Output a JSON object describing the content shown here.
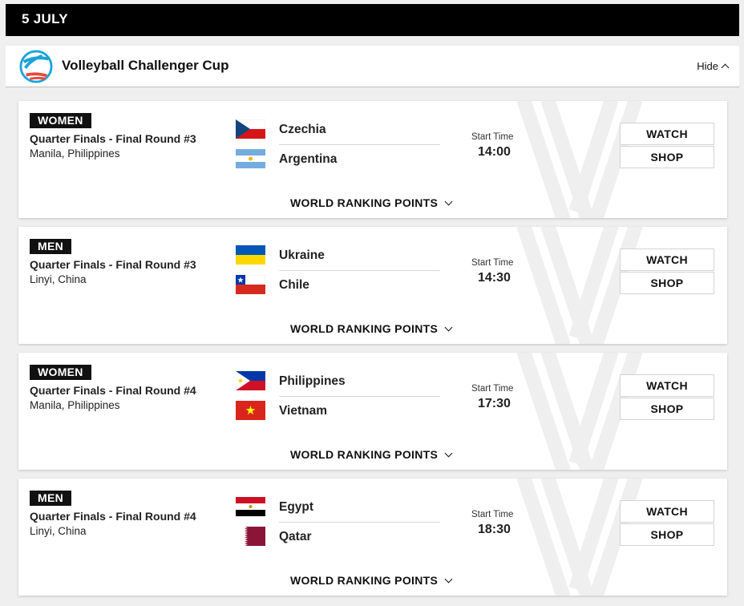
{
  "date_header": "5 JULY",
  "competition": {
    "title": "Volleyball Challenger Cup",
    "hide_label": "Hide"
  },
  "labels": {
    "start_time": "Start Time",
    "watch": "WATCH",
    "shop": "SHOP",
    "ranking_points": "WORLD RANKING POINTS"
  },
  "matches": [
    {
      "gender": "WOMEN",
      "round": "Quarter Finals - Final Round #3",
      "venue": "Manila, Philippines",
      "team1": {
        "name": "Czechia",
        "flag": "czechia-flag"
      },
      "team2": {
        "name": "Argentina",
        "flag": "argentina-flag"
      },
      "start_time": "14:00"
    },
    {
      "gender": "MEN",
      "round": "Quarter Finals - Final Round #3",
      "venue": "Linyi, China",
      "team1": {
        "name": "Ukraine",
        "flag": "ukraine-flag"
      },
      "team2": {
        "name": "Chile",
        "flag": "chile-flag"
      },
      "start_time": "14:30"
    },
    {
      "gender": "WOMEN",
      "round": "Quarter Finals - Final Round #4",
      "venue": "Manila, Philippines",
      "team1": {
        "name": "Philippines",
        "flag": "philippines-flag"
      },
      "team2": {
        "name": "Vietnam",
        "flag": "vietnam-flag"
      },
      "start_time": "17:30"
    },
    {
      "gender": "MEN",
      "round": "Quarter Finals - Final Round #4",
      "venue": "Linyi, China",
      "team1": {
        "name": "Egypt",
        "flag": "egypt-flag"
      },
      "team2": {
        "name": "Qatar",
        "flag": "qatar-flag"
      },
      "start_time": "18:30"
    }
  ]
}
